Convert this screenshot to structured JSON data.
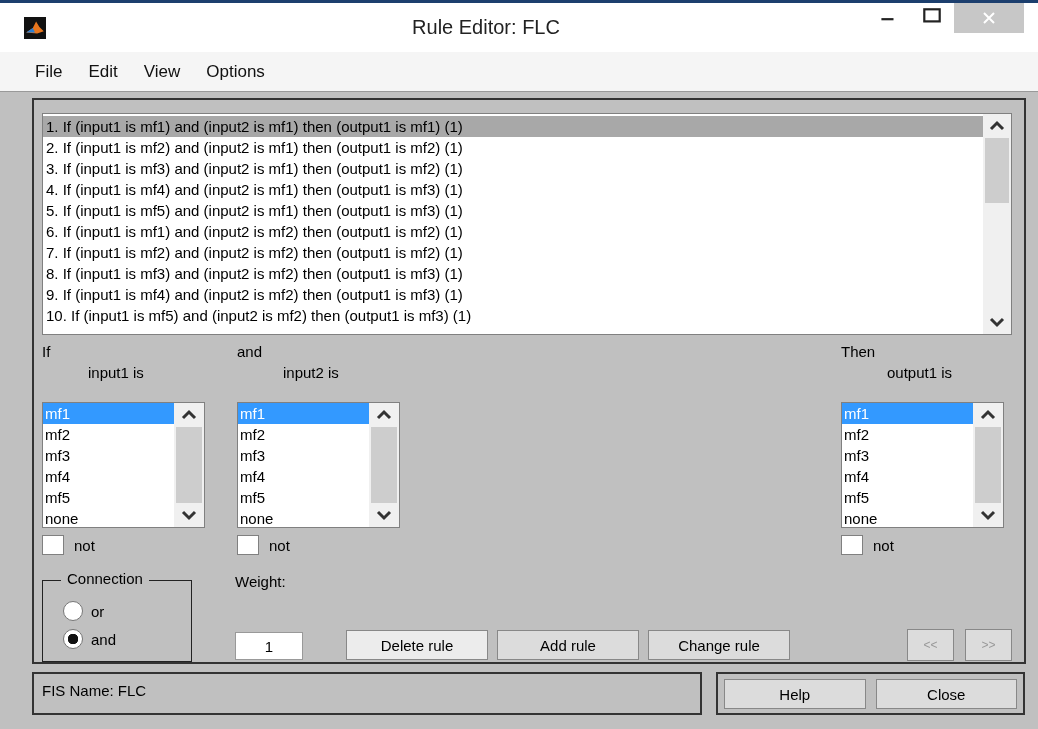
{
  "window": {
    "title": "Rule Editor: FLC"
  },
  "menu": [
    "File",
    "Edit",
    "View",
    "Options"
  ],
  "rules": [
    {
      "text": "1. If (input1 is mf1) and (input2 is mf1) then (output1 is mf1) (1)",
      "selected": true
    },
    {
      "text": "2. If (input1 is mf2) and (input2 is mf1) then (output1 is mf2) (1)",
      "selected": false
    },
    {
      "text": "3. If (input1 is mf3) and (input2 is mf1) then (output1 is mf2) (1)",
      "selected": false
    },
    {
      "text": "4. If (input1 is mf4) and (input2 is mf1) then (output1 is mf3) (1)",
      "selected": false
    },
    {
      "text": "5. If (input1 is mf5) and (input2 is mf1) then (output1 is mf3) (1)",
      "selected": false
    },
    {
      "text": "6. If (input1 is mf1) and (input2 is mf2) then (output1 is mf2) (1)",
      "selected": false
    },
    {
      "text": "7. If (input1 is mf2) and (input2 is mf2) then (output1 is mf2) (1)",
      "selected": false
    },
    {
      "text": "8. If (input1 is mf3) and (input2 is mf2) then (output1 is mf3) (1)",
      "selected": false
    },
    {
      "text": "9. If (input1 is mf4) and (input2 is mf2) then (output1 is mf3) (1)",
      "selected": false
    },
    {
      "text": "10. If (input1 is mf5) and (input2 is mf2) then (output1 is mf3) (1)",
      "selected": false
    }
  ],
  "selectors": [
    {
      "connective": "If",
      "label": "input1 is",
      "not_label": "not",
      "not_checked": false,
      "items": [
        {
          "label": "mf1",
          "selected": true
        },
        {
          "label": "mf2",
          "selected": false
        },
        {
          "label": "mf3",
          "selected": false
        },
        {
          "label": "mf4",
          "selected": false
        },
        {
          "label": "mf5",
          "selected": false
        },
        {
          "label": "none",
          "selected": false
        }
      ]
    },
    {
      "connective": "and",
      "label": "input2 is",
      "not_label": "not",
      "not_checked": false,
      "items": [
        {
          "label": "mf1",
          "selected": true
        },
        {
          "label": "mf2",
          "selected": false
        },
        {
          "label": "mf3",
          "selected": false
        },
        {
          "label": "mf4",
          "selected": false
        },
        {
          "label": "mf5",
          "selected": false
        },
        {
          "label": "none",
          "selected": false
        }
      ]
    },
    {
      "connective": "Then",
      "label": "output1 is",
      "not_label": "not",
      "not_checked": false,
      "items": [
        {
          "label": "mf1",
          "selected": true
        },
        {
          "label": "mf2",
          "selected": false
        },
        {
          "label": "mf3",
          "selected": false
        },
        {
          "label": "mf4",
          "selected": false
        },
        {
          "label": "mf5",
          "selected": false
        },
        {
          "label": "none",
          "selected": false
        }
      ]
    }
  ],
  "connection": {
    "title": "Connection",
    "options": [
      {
        "label": "or",
        "selected": false
      },
      {
        "label": "and",
        "selected": true
      }
    ]
  },
  "weight": {
    "label": "Weight:",
    "value": "1"
  },
  "actions": [
    {
      "label": "Delete rule",
      "disabled": false
    },
    {
      "label": "Add rule",
      "disabled": false
    },
    {
      "label": "Change rule",
      "disabled": false
    }
  ],
  "nav": [
    {
      "label": "<<",
      "disabled": true
    },
    {
      "label": ">>",
      "disabled": true
    }
  ],
  "status": "FIS Name: FLC",
  "footer_buttons": [
    "Help",
    "Close"
  ]
}
